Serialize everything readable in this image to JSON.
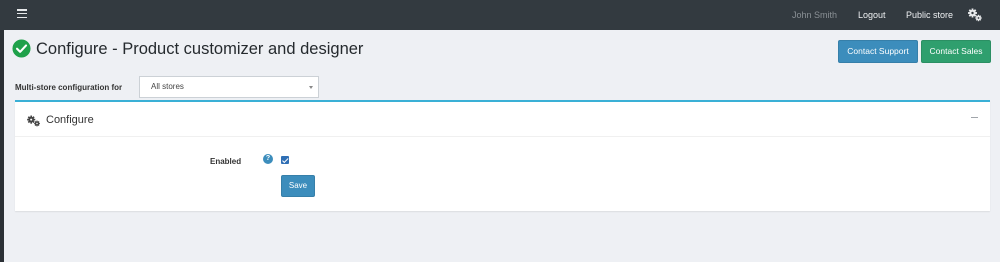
{
  "topbar": {
    "menu_icon": "hamburger-icon",
    "user_name": "John Smith",
    "logout_label": "Logout",
    "public_store_label": "Public store",
    "settings_icon": "gears-icon"
  },
  "header": {
    "title": "Configure - Product customizer and designer",
    "status_icon": "check-circle-icon",
    "contact_support_label": "Contact Support",
    "contact_sales_label": "Contact Sales"
  },
  "multistore": {
    "label": "Multi-store configuration for",
    "selected": "All stores"
  },
  "card": {
    "icon": "gears-icon",
    "title": "Configure",
    "collapse_icon": "minus-icon",
    "fields": {
      "enabled_label": "Enabled",
      "enabled_help_icon": "?",
      "enabled_checked": true
    },
    "save_label": "Save"
  },
  "colors": {
    "navbar": "#333a40",
    "primary": "#3c8dbc",
    "success": "#2f9f6e",
    "check": "#1fa14a",
    "card_accent": "#3ab0d6"
  }
}
